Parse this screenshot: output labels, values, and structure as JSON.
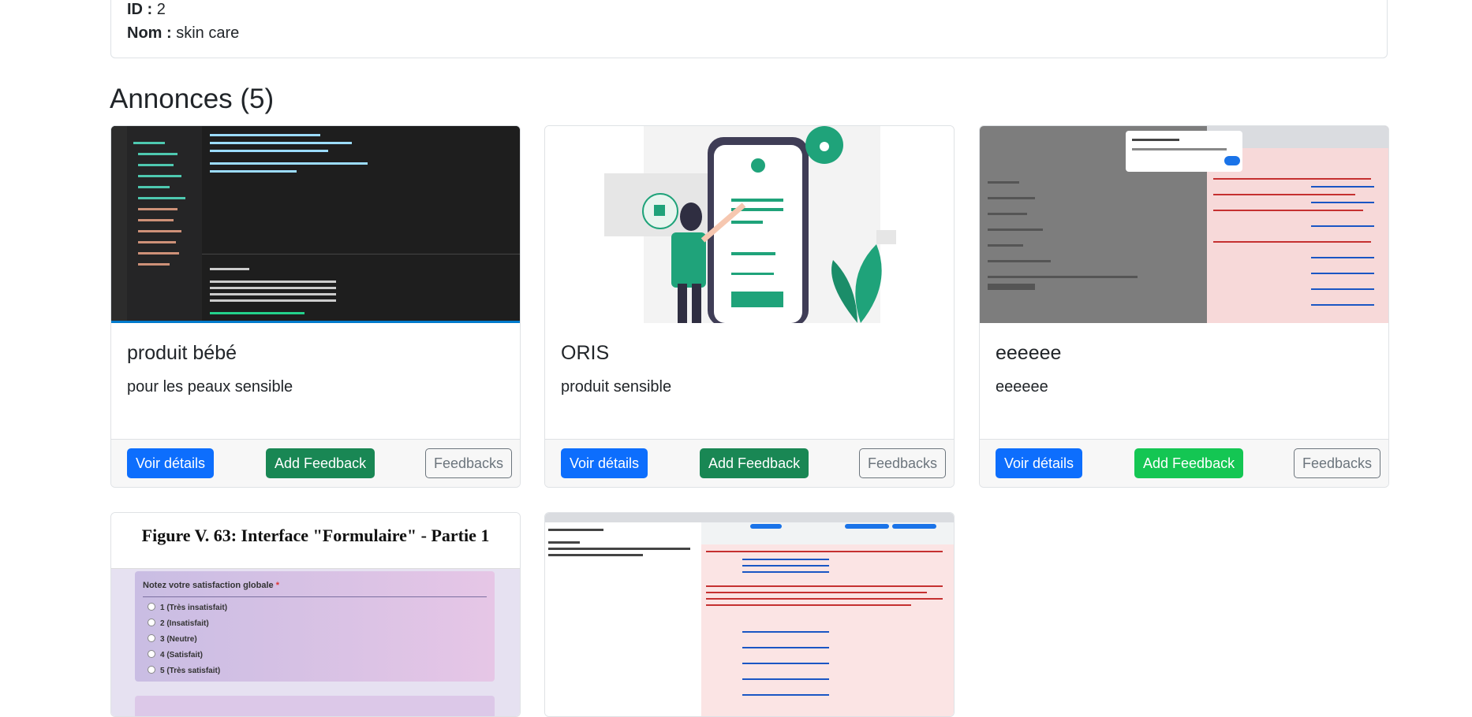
{
  "category": {
    "id_label": "ID :",
    "id_value": "2",
    "name_label": "Nom :",
    "name_value": "skin care"
  },
  "section": {
    "title": "Annonces (5)"
  },
  "cards": [
    {
      "title": "produit bébé",
      "description": "pour les peaux sensible",
      "image": "code-editor-screenshot",
      "buttons": {
        "details": "Voir détails",
        "add_feedback": "Add Feedback",
        "feedbacks": "Feedbacks"
      }
    },
    {
      "title": "ORIS",
      "description": "produit sensible",
      "image": "phone-form-illustration",
      "buttons": {
        "details": "Voir détails",
        "add_feedback": "Add Feedback",
        "feedbacks": "Feedbacks"
      }
    },
    {
      "title": "eeeeee",
      "description": "eeeeee",
      "image": "browser-devtools-screenshot",
      "buttons": {
        "details": "Voir détails",
        "add_feedback": "Add Feedback",
        "feedbacks": "Feedbacks"
      }
    },
    {
      "image": "form-interface-figure",
      "figure_caption": "Figure V. 63: Interface \"Formulaire\" - Partie 1",
      "form": {
        "question": "Notez votre satisfaction globale",
        "required_mark": "*",
        "options": [
          "1 (Très insatisfait)",
          "2 (Insatisfait)",
          "3 (Neutre)",
          "4 (Satisfait)",
          "5 (Très satisfait)"
        ]
      }
    },
    {
      "image": "browser-console-errors-screenshot"
    }
  ],
  "colors": {
    "primary": "#0d6efd",
    "success": "#198754",
    "success_hover": "#14c653",
    "secondary": "#6c757d",
    "accent_green": "#1fa37a"
  }
}
